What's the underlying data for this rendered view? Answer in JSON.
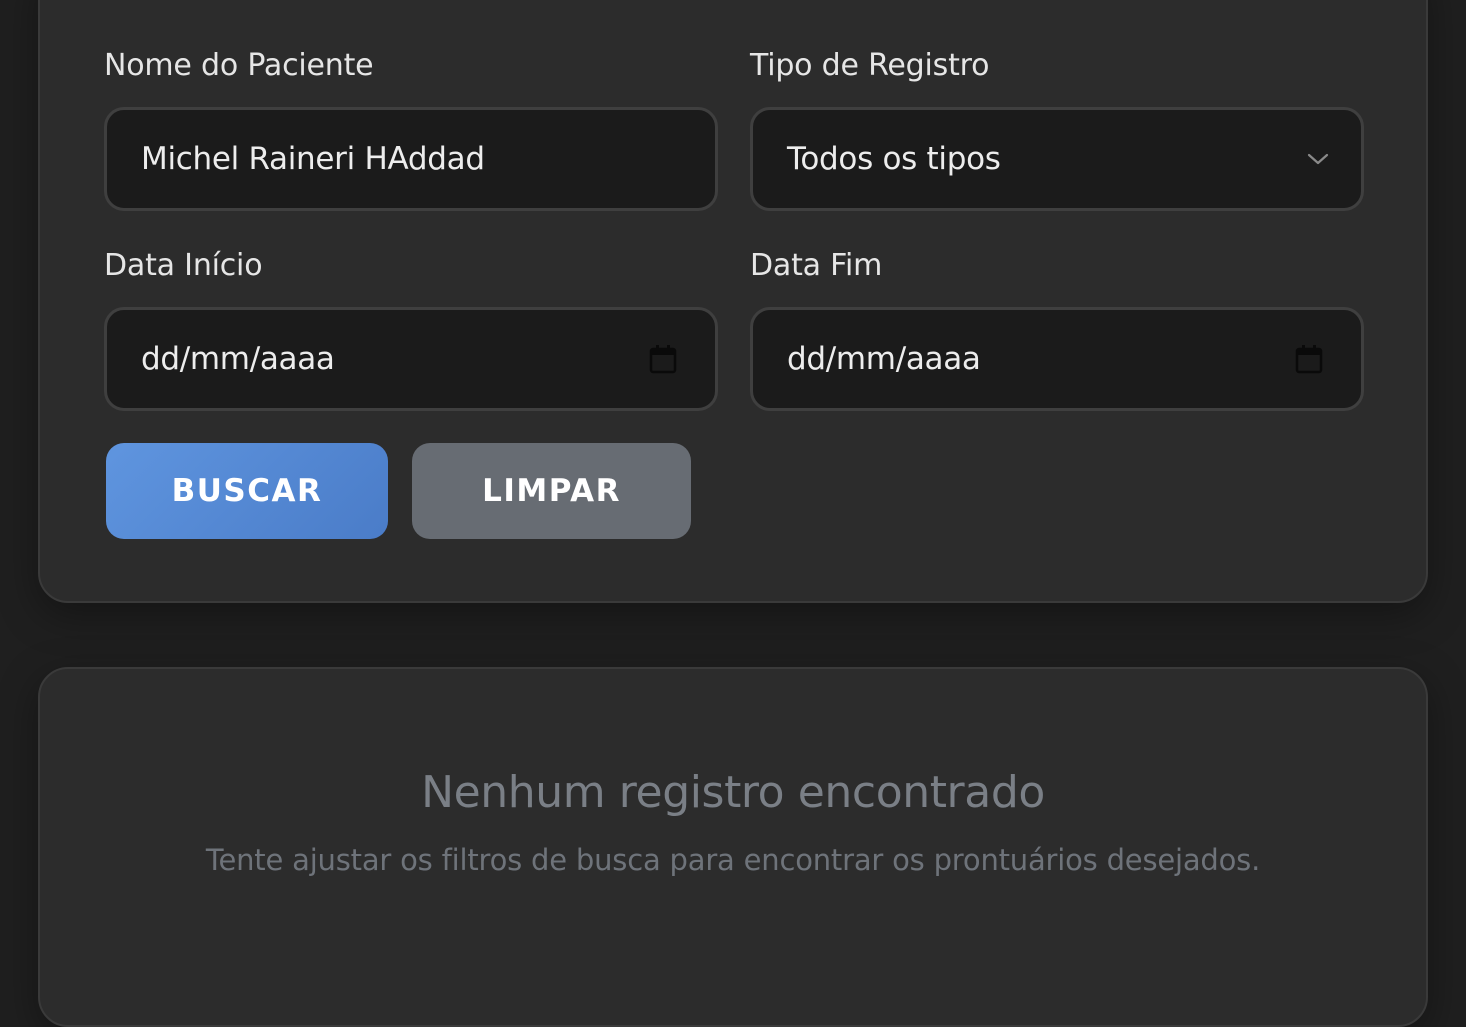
{
  "filters": {
    "patient_name": {
      "label": "Nome do Paciente",
      "value": "Michel Raineri HAddad"
    },
    "record_type": {
      "label": "Tipo de Registro",
      "selected": "Todos os tipos",
      "icon": "chevron-down-icon"
    },
    "start_date": {
      "label": "Data Início",
      "placeholder": "dd/mm/aaaa",
      "icon": "calendar-icon"
    },
    "end_date": {
      "label": "Data Fim",
      "placeholder": "dd/mm/aaaa",
      "icon": "calendar-icon"
    },
    "search_button": "BUSCAR",
    "clear_button": "LIMPAR"
  },
  "results": {
    "empty_title": "Nenhum registro encontrado",
    "empty_message": "Tente ajustar os filtros de busca para encontrar os prontuários desejados."
  },
  "colors": {
    "page_background": "#1f1f1f",
    "card_background": "#2c2c2c",
    "input_background": "#1b1b1b",
    "primary_button": "#5b8fd9",
    "secondary_button": "#676c73",
    "muted_text": "#7a7f86"
  }
}
